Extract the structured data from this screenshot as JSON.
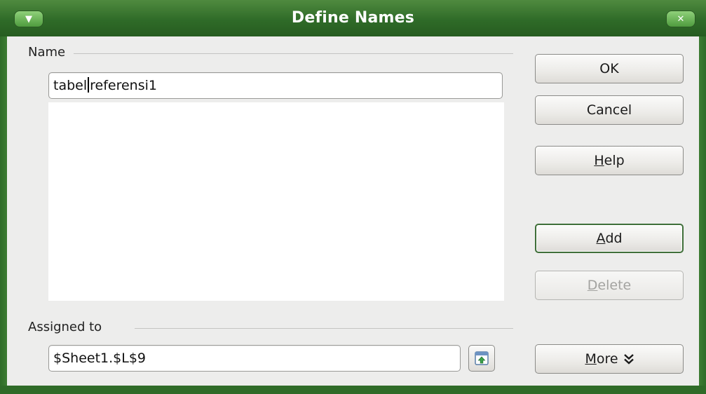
{
  "window": {
    "title": "Define Names",
    "menu_icon": "window-menu-icon",
    "close_icon": "close-icon"
  },
  "name_section": {
    "label": "Name",
    "input_before_caret": "tabel",
    "input_after_caret": "referensi1",
    "list_items": []
  },
  "assigned_section": {
    "label": "Assigned to",
    "value": "$Sheet1.$L$9",
    "shrink_icon": "shrink-reference-icon"
  },
  "buttons": {
    "ok": "OK",
    "cancel": "Cancel",
    "help_mnemonic": "H",
    "help_rest": "elp",
    "add_mnemonic": "A",
    "add_rest": "dd",
    "delete_mnemonic": "D",
    "delete_rest": "elete",
    "more_mnemonic": "M",
    "more_rest": "ore",
    "more_icon": "double-chevron-down-icon"
  },
  "colors": {
    "titlebar": "#2f6b28",
    "dialog_bg": "#ededec",
    "default_button_border": "#3f6f39"
  }
}
